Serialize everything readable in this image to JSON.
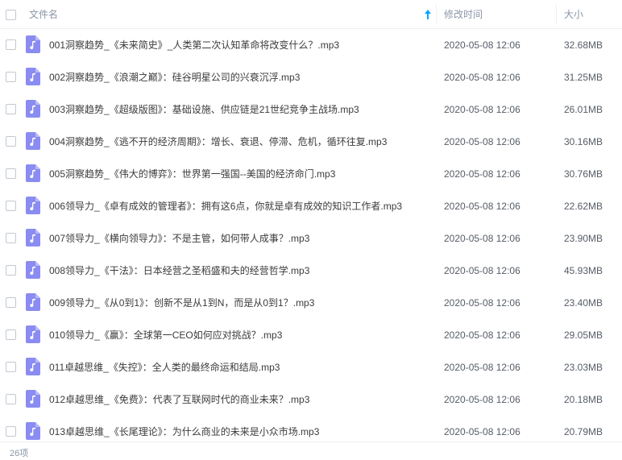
{
  "header": {
    "name_label": "文件名",
    "date_label": "修改时间",
    "size_label": "大小",
    "sort_icon": "arrow-up-icon"
  },
  "colors": {
    "accent": "#06a7ff",
    "file_icon": "#8a8cf2"
  },
  "files": [
    {
      "name": "001洞察趋势_《未来简史》_人类第二次认知革命将改变什么？.mp3",
      "date": "2020-05-08 12:06",
      "size": "32.68MB"
    },
    {
      "name": "002洞察趋势_《浪潮之巅》：硅谷明星公司的兴衰沉浮.mp3",
      "date": "2020-05-08 12:06",
      "size": "31.25MB"
    },
    {
      "name": "003洞察趋势_《超级版图》：基础设施、供应链是21世纪竞争主战场.mp3",
      "date": "2020-05-08 12:06",
      "size": "26.01MB"
    },
    {
      "name": "004洞察趋势_《逃不开的经济周期》：增长、衰退、停滞、危机，循环往复.mp3",
      "date": "2020-05-08 12:06",
      "size": "30.16MB"
    },
    {
      "name": "005洞察趋势_《伟大的博弈》：世界第一强国--美国的经济命门.mp3",
      "date": "2020-05-08 12:06",
      "size": "30.76MB"
    },
    {
      "name": "006领导力_《卓有成效的管理者》：拥有这6点，你就是卓有成效的知识工作者.mp3",
      "date": "2020-05-08 12:06",
      "size": "22.62MB"
    },
    {
      "name": "007领导力_《横向领导力》：不是主管，如何带人成事？.mp3",
      "date": "2020-05-08 12:06",
      "size": "23.90MB"
    },
    {
      "name": "008领导力_《干法》：日本经营之圣稻盛和夫的经营哲学.mp3",
      "date": "2020-05-08 12:06",
      "size": "45.93MB"
    },
    {
      "name": "009领导力_《从0到1》：创新不是从1到N，而是从0到1？.mp3",
      "date": "2020-05-08 12:06",
      "size": "23.40MB"
    },
    {
      "name": "010领导力_《赢》：全球第一CEO如何应对挑战？.mp3",
      "date": "2020-05-08 12:06",
      "size": "29.05MB"
    },
    {
      "name": "011卓越思维_《失控》：全人类的最终命运和结局.mp3",
      "date": "2020-05-08 12:06",
      "size": "23.03MB"
    },
    {
      "name": "012卓越思维_《免费》：代表了互联网时代的商业未来？.mp3",
      "date": "2020-05-08 12:06",
      "size": "20.18MB"
    },
    {
      "name": "013卓越思维_《长尾理论》：为什么商业的未来是小众市场.mp3",
      "date": "2020-05-08 12:06",
      "size": "20.79MB"
    }
  ],
  "footer": {
    "count": "26项"
  }
}
